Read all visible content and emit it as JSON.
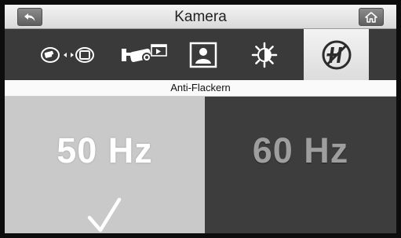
{
  "header": {
    "title": "Kamera"
  },
  "icons": {
    "back": "back-arrow-icon",
    "home": "home-icon",
    "camera_to_screen": "camera-to-screen-icon",
    "camera_record": "camera-record-icon",
    "portrait": "portrait-icon",
    "brightness": "brightness-icon",
    "anti_flicker": "anti-flicker-icon",
    "check": "checkmark-icon"
  },
  "section": {
    "label": "Anti-Flackern"
  },
  "options": [
    {
      "label": "50 Hz",
      "selected": true
    },
    {
      "label": "60 Hz",
      "selected": false
    }
  ],
  "colors": {
    "selected_panel": "#c9c9c9",
    "unselected_panel": "#3d3d3d",
    "title_bar": "#e6e6e6"
  }
}
